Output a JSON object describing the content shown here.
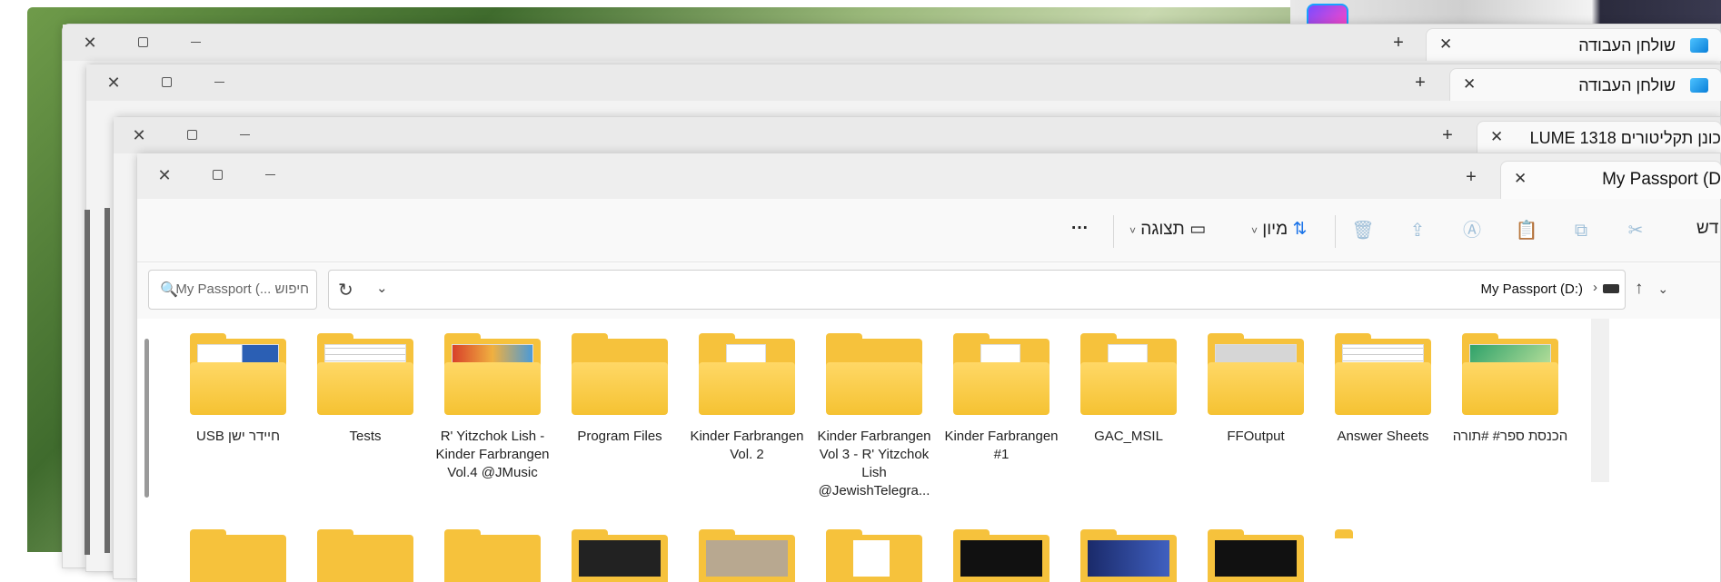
{
  "windows": {
    "w1": {
      "tab_title": "שולחן העבודה",
      "new_tab": "+",
      "close": "✕"
    },
    "w2": {
      "tab_title": "שולחן העבודה",
      "new_tab": "+",
      "close": "✕"
    },
    "w3": {
      "tab_title": "כונן תקליטורים LUME 1318",
      "new_tab": "+",
      "close": "✕"
    }
  },
  "front": {
    "tab_title": "My Passport (D",
    "new_tab": "+",
    "tab_close": "✕",
    "controls": {
      "close": "✕"
    },
    "toolbar": {
      "new_label": "דש",
      "sort_label": "מיון",
      "view_label": "תצוגה",
      "more": "···",
      "icons": [
        "new-icon",
        "cut-icon",
        "copy-icon",
        "paste-icon",
        "rename-icon",
        "share-icon",
        "delete-icon",
        "sort-icon",
        "view-icon",
        "more-icon"
      ]
    },
    "search": {
      "placeholder": "חיפוש ‪My Passport (...‬"
    },
    "address": {
      "crumb": "My Passport (D:)",
      "sep": "›"
    },
    "items": [
      {
        "label": "הכנסת ספר# #תורה",
        "thumb": "image"
      },
      {
        "label": "Answer Sheets",
        "thumb": "doc"
      },
      {
        "label": "FFOutput",
        "thumb": "image"
      },
      {
        "label": "GAC_MSIL",
        "thumb": "gear"
      },
      {
        "label": "Kinder Farbrangen #1",
        "thumb": "audio"
      },
      {
        "label": "Kinder Farbrangen Vol 3 - R' Yitzchok Lish @JewishTelegra...",
        "thumb": "empty"
      },
      {
        "label": "Kinder Farbrangen Vol. 2",
        "thumb": "audio"
      },
      {
        "label": "Program Files",
        "thumb": "empty"
      },
      {
        "label": "R' Yitzchok Lish - Kinder Farbrangen Vol.4 @JMusic",
        "thumb": "image"
      },
      {
        "label": "Tests",
        "thumb": "doc"
      },
      {
        "label": "חיידר ישן USB",
        "thumb": "doc"
      }
    ]
  }
}
